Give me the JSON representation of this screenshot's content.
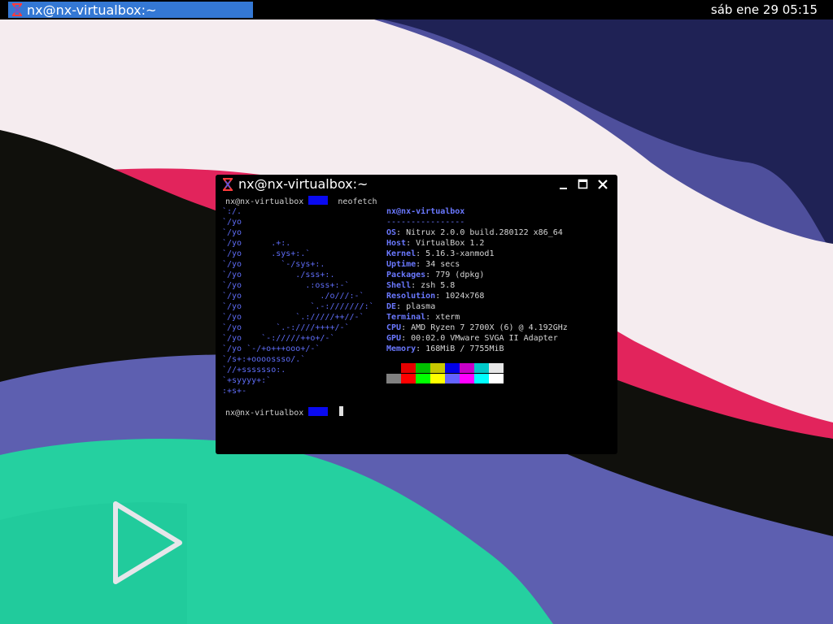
{
  "topbar": {
    "task_title": "nx@nx-virtualbox:~",
    "clock": "sáb ene 29 05:15"
  },
  "window": {
    "title": "nx@nx-virtualbox:~",
    "prompt_host": "nx@nx-virtualbox",
    "command": "neofetch"
  },
  "ascii_art": [
    "`:/.",
    "`/yo",
    "`/yo",
    "`/yo      .+:.",
    "`/yo      .sys+:.`",
    "`/yo        `-/sys+:.",
    "`/yo           ./sss+:.",
    "`/yo             .:oss+:-`",
    "`/yo                ./o///:-`",
    "`/yo              `.-:///////:`",
    "`/yo           `.://///++//-`",
    "`/yo       `.-:////++++/-`",
    "`/yo    `-://///++o+/-`",
    "`/yo `-/+o+++ooo+/-`",
    "`/s+:+oooossso/.`",
    "`//+sssssso:.",
    "`+syyyy+:`",
    ":+s+-"
  ],
  "info": {
    "header": "nx@nx-virtualbox",
    "separator": "----------------",
    "rows": [
      {
        "key": "OS",
        "value": "Nitrux 2.0.0 build.280122 x86_64"
      },
      {
        "key": "Host",
        "value": "VirtualBox 1.2"
      },
      {
        "key": "Kernel",
        "value": "5.16.3-xanmod1"
      },
      {
        "key": "Uptime",
        "value": "34 secs"
      },
      {
        "key": "Packages",
        "value": "779 (dpkg)"
      },
      {
        "key": "Shell",
        "value": "zsh 5.8"
      },
      {
        "key": "Resolution",
        "value": "1024x768"
      },
      {
        "key": "DE",
        "value": "plasma"
      },
      {
        "key": "Terminal",
        "value": "xterm"
      },
      {
        "key": "CPU",
        "value": "AMD Ryzen 7 2700X (6) @ 4.192GHz"
      },
      {
        "key": "GPU",
        "value": "00:02.0 VMware SVGA II Adapter"
      },
      {
        "key": "Memory",
        "value": "168MiB / 7755MiB"
      }
    ]
  },
  "palette": {
    "dark": [
      "#000000",
      "#e60000",
      "#00c000",
      "#c8c800",
      "#0000e6",
      "#c800c8",
      "#00c8c8",
      "#e6e6e6"
    ],
    "bright": [
      "#808080",
      "#ff0000",
      "#00ff00",
      "#ffff00",
      "#6464ff",
      "#ff00ff",
      "#00ffff",
      "#ffffff"
    ]
  },
  "icons": {
    "app": "nitrux-x-icon",
    "minimize": "minimize-icon",
    "maximize": "maximize-icon",
    "close": "close-icon",
    "desktop_logo": "nitrux-play-logo"
  }
}
